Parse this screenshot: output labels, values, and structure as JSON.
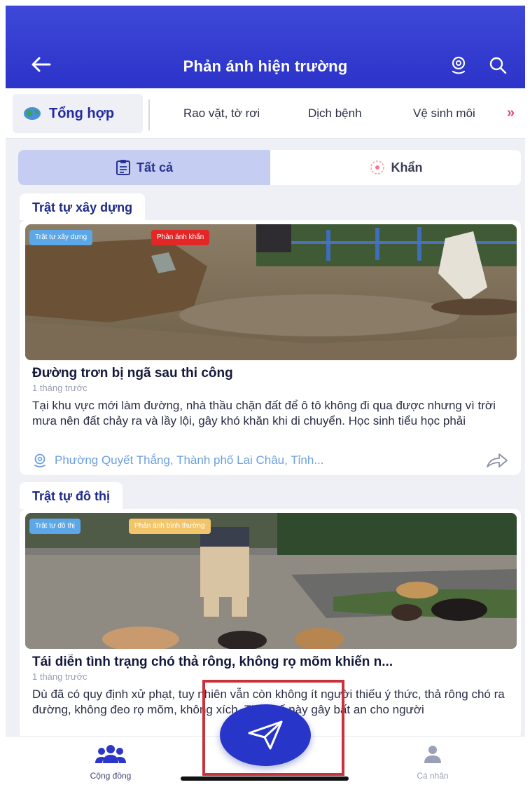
{
  "header": {
    "title": "Phản ánh hiện trường"
  },
  "categories": {
    "main": "Tổng hợp",
    "items": [
      "Rao vặt, tờ rơi",
      "Dịch bệnh",
      "Vệ sinh môi"
    ],
    "more": "»"
  },
  "filter": {
    "all": "Tất cả",
    "urgent": "Khẩn"
  },
  "posts": [
    {
      "section": "Trật tự xây dựng",
      "badges": [
        "Trật tự xây dựng",
        "Phản ánh khẩn"
      ],
      "title": "Đường trơn bị ngã sau thi công",
      "time": "1 tháng trước",
      "body": "Tại khu vực mới làm đường, nhà thầu chặn đất để ô tô không đi qua được nhưng vì trời mưa nên đất chảy ra và lầy lội, gây khó khăn khi di chuyển. Học sinh tiểu học phải",
      "location": "Phường Quyết Thắng, Thành phố Lai Châu, Tỉnh..."
    },
    {
      "section": "Trật tự đô thị",
      "badges": [
        "Trật tự đô thị",
        "Phản ánh bình thường"
      ],
      "title": "Tái diễn tình trạng chó thả rông, không rọ mõm khiến n...",
      "time": "1 tháng trước",
      "body": "Dù đã có quy định xử phạt, tuy nhiên vẫn còn không ít người thiếu ý thức, thả rông chó ra đường, không đeo rọ mõm, không xích. Thực tế này gây bất an cho người"
    }
  ],
  "bottom_nav": {
    "community": "Cộng đồng",
    "profile": "Cá nhân"
  },
  "icons": {
    "back": "arrow-left-icon",
    "location": "map-pin-icon",
    "search": "search-icon",
    "fab": "send-icon"
  },
  "colors": {
    "header": "#2f38cc",
    "accent": "#2736c9",
    "urgent_badge": "#e32727",
    "normal_badge": "#f3c56a",
    "category_badge": "#5ca7e8",
    "highlight_box": "#c8323c"
  }
}
